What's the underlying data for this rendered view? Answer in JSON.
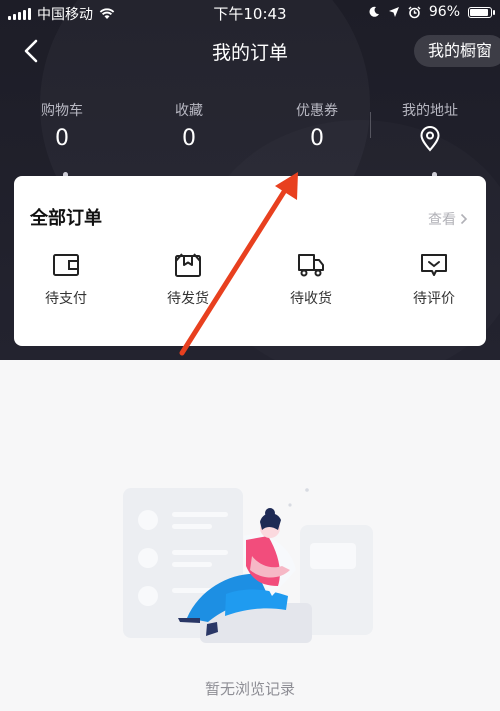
{
  "status_bar": {
    "carrier": "中国移动",
    "time": "下午10:43",
    "battery": "96%",
    "battery_level": 0.96
  },
  "nav": {
    "title": "我的订单",
    "showcase_label": "我的橱窗"
  },
  "stats": [
    {
      "label": "购物车",
      "value": "0"
    },
    {
      "label": "收藏",
      "value": "0"
    },
    {
      "label": "优惠券",
      "value": "0"
    },
    {
      "label": "我的地址",
      "icon": "location-icon"
    }
  ],
  "orders": {
    "title": "全部订单",
    "view_all": "查看",
    "items": [
      {
        "label": "待支付",
        "icon": "wallet-icon"
      },
      {
        "label": "待发货",
        "icon": "package-icon"
      },
      {
        "label": "待收货",
        "icon": "truck-icon"
      },
      {
        "label": "待评价",
        "icon": "comment-icon"
      }
    ]
  },
  "empty_state": {
    "message": "暂无浏览记录"
  },
  "colors": {
    "header_bg": "#1d1d27",
    "annotation_arrow": "#e8401f",
    "card_bg": "#ffffff"
  }
}
